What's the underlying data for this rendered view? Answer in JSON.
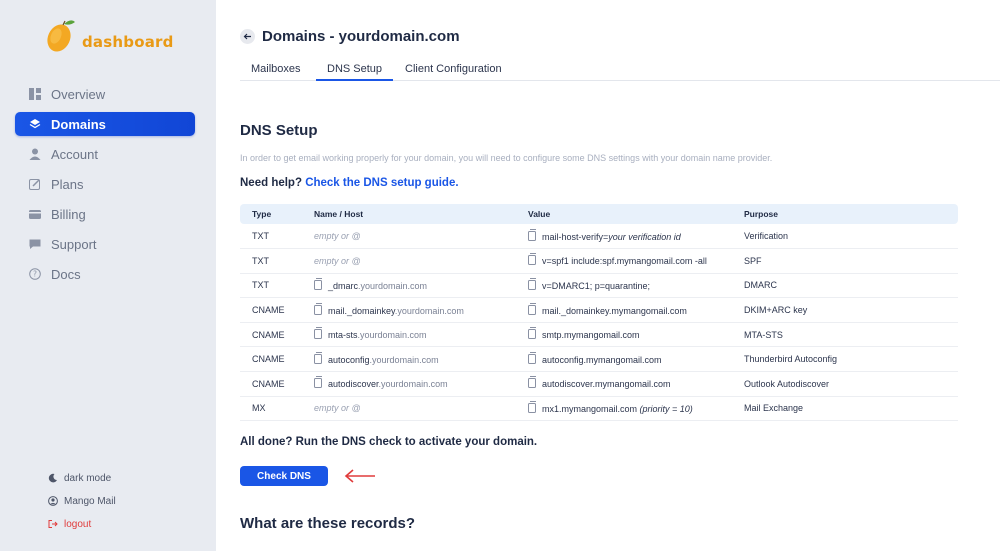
{
  "brand": {
    "name": "dashboard",
    "accent": "#e99a16"
  },
  "sidebar": {
    "items": [
      {
        "label": "Overview",
        "icon": "overview-grid-icon",
        "active": false
      },
      {
        "label": "Domains",
        "icon": "layers-icon",
        "active": true
      },
      {
        "label": "Account",
        "icon": "user-icon",
        "active": false
      },
      {
        "label": "Plans",
        "icon": "pencil-icon",
        "active": false
      },
      {
        "label": "Billing",
        "icon": "credit-card-icon",
        "active": false
      },
      {
        "label": "Support",
        "icon": "chat-icon",
        "active": false
      },
      {
        "label": "Docs",
        "icon": "question-icon",
        "active": false
      }
    ],
    "bottom": {
      "dark_mode": "dark mode",
      "user": "Mango Mail",
      "logout": "logout"
    }
  },
  "header": {
    "title": "Domains - yourdomain.com"
  },
  "tabs": [
    {
      "label": "Mailboxes",
      "active": false
    },
    {
      "label": "DNS Setup",
      "active": true
    },
    {
      "label": "Client Configuration",
      "active": false
    }
  ],
  "dns": {
    "title": "DNS Setup",
    "intro": "In order to get email working properly for your domain, you will need to configure some DNS settings with your domain name provider.",
    "help_prefix": "Need help?",
    "help_link": "Check the DNS setup guide.",
    "columns": [
      "Type",
      "Name / Host",
      "Value",
      "Purpose"
    ],
    "rows": [
      {
        "type": "TXT",
        "host_prefix": "",
        "host": "empty or @",
        "host_empty": true,
        "value": "mail-host-verify=",
        "value_em": "your verification id",
        "purpose": "Verification"
      },
      {
        "type": "TXT",
        "host_prefix": "",
        "host": "empty or @",
        "host_empty": true,
        "value": "v=spf1 include:spf.mymangomail.com -all",
        "value_em": "",
        "purpose": "SPF"
      },
      {
        "type": "TXT",
        "host_prefix": "_dmarc",
        "host": ".yourdomain.com",
        "host_empty": false,
        "value": "v=DMARC1; p=quarantine;",
        "value_em": "",
        "purpose": "DMARC"
      },
      {
        "type": "CNAME",
        "host_prefix": "mail._domainkey",
        "host": ".yourdomain.com",
        "host_empty": false,
        "value": "mail._domainkey.mymangomail.com",
        "value_em": "",
        "purpose": "DKIM+ARC key"
      },
      {
        "type": "CNAME",
        "host_prefix": "mta-sts",
        "host": ".yourdomain.com",
        "host_empty": false,
        "value": "smtp.mymangomail.com",
        "value_em": "",
        "purpose": "MTA-STS"
      },
      {
        "type": "CNAME",
        "host_prefix": "autoconfig",
        "host": ".yourdomain.com",
        "host_empty": false,
        "value": "autoconfig.mymangomail.com",
        "value_em": "",
        "purpose": "Thunderbird Autoconfig"
      },
      {
        "type": "CNAME",
        "host_prefix": "autodiscover",
        "host": ".yourdomain.com",
        "host_empty": false,
        "value": "autodiscover.mymangomail.com",
        "value_em": "",
        "purpose": "Outlook Autodiscover"
      },
      {
        "type": "MX",
        "host_prefix": "",
        "host": "empty or @",
        "host_empty": true,
        "value": "mx1.mymangomail.com ",
        "value_em": "(priority = 10)",
        "purpose": "Mail Exchange"
      }
    ],
    "all_done": "All done? Run the DNS check to activate your domain.",
    "check_button": "Check DNS",
    "records_title": "What are these records?"
  },
  "colors": {
    "primary": "#1a56e6",
    "annotation_arrow": "#e03b3b"
  }
}
